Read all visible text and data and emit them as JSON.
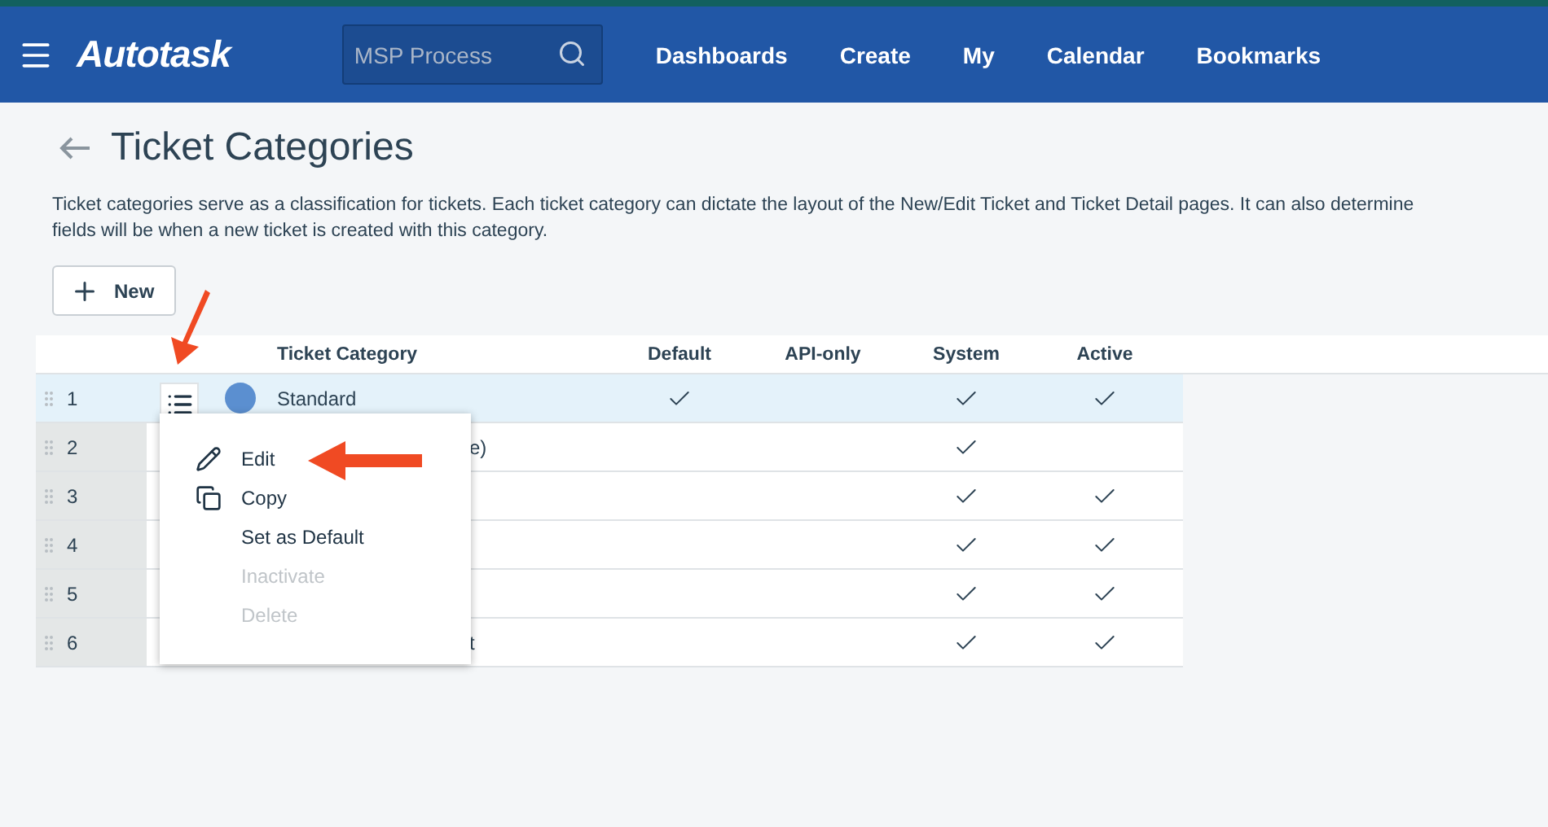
{
  "header": {
    "logo": "Autotask",
    "search": {
      "value": "MSP Process"
    },
    "nav": [
      "Dashboards",
      "Create",
      "My",
      "Calendar",
      "Bookmarks"
    ]
  },
  "page": {
    "title": "Ticket Categories",
    "description": [
      "Ticket categories serve as a classification for tickets. Each ticket category can dictate the layout of the New/Edit Ticket and Ticket Detail pages. It can also determine",
      "fields will be when a new ticket is created with this category."
    ],
    "new_button": "New"
  },
  "table": {
    "columns": [
      "Ticket Category",
      "Default",
      "API-only",
      "System",
      "Active"
    ],
    "rows": [
      {
        "number": "1",
        "kind": "full",
        "selected": true,
        "color": "#5b8fd0",
        "category": "Standard",
        "default": true,
        "api_only": false,
        "system": true,
        "active": true
      },
      {
        "number": "2",
        "kind": "covered",
        "selected": false,
        "category": "e)",
        "default": false,
        "api_only": false,
        "system": true,
        "active": false
      },
      {
        "number": "3",
        "kind": "covered",
        "selected": false,
        "default": false,
        "api_only": false,
        "system": true,
        "active": true
      },
      {
        "number": "4",
        "kind": "covered",
        "selected": false,
        "default": false,
        "api_only": false,
        "system": true,
        "active": true
      },
      {
        "number": "5",
        "kind": "covered",
        "selected": false,
        "default": false,
        "api_only": false,
        "system": true,
        "active": true
      },
      {
        "number": "6",
        "kind": "covered",
        "selected": false,
        "category": "t",
        "default": false,
        "api_only": false,
        "system": true,
        "active": true
      }
    ]
  },
  "context_menu": [
    {
      "label": "Edit",
      "disabled": false
    },
    {
      "label": "Copy",
      "disabled": false
    },
    {
      "label": "Set as Default",
      "disabled": false
    },
    {
      "label": "Inactivate",
      "disabled": true
    },
    {
      "label": "Delete",
      "disabled": true
    }
  ]
}
